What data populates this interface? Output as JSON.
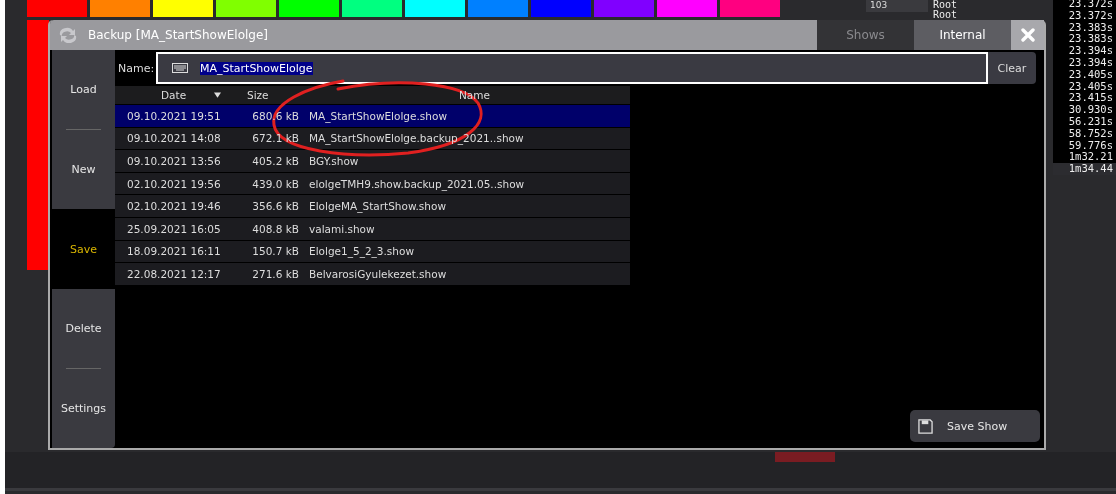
{
  "background": {
    "swatches": [
      {
        "color": "#ff0000"
      },
      {
        "color": "#ff8000"
      },
      {
        "color": "#ffff00"
      },
      {
        "color": "#80ff00"
      },
      {
        "color": "#00ff00"
      },
      {
        "color": "#00ff80"
      },
      {
        "color": "#00ffff"
      },
      {
        "color": "#0080ff"
      },
      {
        "color": "#0000ff"
      },
      {
        "color": "#8000ff"
      },
      {
        "color": "#ff00ff"
      },
      {
        "color": "#ff0080"
      }
    ],
    "counter": "103",
    "roots": [
      "Root",
      "Root"
    ],
    "timings": [
      {
        "text": "23.372s",
        "selected": false
      },
      {
        "text": "23.372s",
        "selected": false
      },
      {
        "text": "23.383s",
        "selected": false
      },
      {
        "text": "23.383s",
        "selected": false
      },
      {
        "text": "23.394s",
        "selected": false
      },
      {
        "text": "23.394s",
        "selected": false
      },
      {
        "text": "23.405s",
        "selected": false
      },
      {
        "text": "23.405s",
        "selected": false
      },
      {
        "text": "23.415s",
        "selected": false
      },
      {
        "text": "30.930s",
        "selected": false
      },
      {
        "text": "56.231s",
        "selected": false
      },
      {
        "text": "58.752s",
        "selected": false
      },
      {
        "text": "59.776s",
        "selected": false
      },
      {
        "text": "1m32.21",
        "selected": false
      },
      {
        "text": "1m34.44",
        "selected": true
      }
    ]
  },
  "window": {
    "title": "Backup [MA_StartShowElolge]",
    "tabs": [
      {
        "label": "Shows",
        "selected": false
      },
      {
        "label": "Internal",
        "selected": true
      }
    ],
    "name_field": {
      "label": "Name:",
      "value": "MA_StartShowElolge"
    },
    "clear_button": "Clear",
    "sidebar": [
      {
        "label": "Load",
        "selected": false
      },
      {
        "label": "New",
        "selected": false
      },
      {
        "label": "Save",
        "selected": true
      },
      {
        "label": "Delete",
        "selected": false
      },
      {
        "label": "Settings",
        "selected": false
      }
    ],
    "table": {
      "columns": [
        {
          "label": "Date",
          "sorted": true
        },
        {
          "label": "Size",
          "sorted": false
        },
        {
          "label": "Name",
          "sorted": false
        }
      ],
      "rows": [
        {
          "date": "09.10.2021 19:51",
          "size": "680.6 kB",
          "name": "MA_StartShowElolge.show",
          "selected": true
        },
        {
          "date": "09.10.2021 14:08",
          "size": "672.1 kB",
          "name": "MA_StartShowElolge.backup_2021..show",
          "selected": false
        },
        {
          "date": "09.10.2021 13:56",
          "size": "405.2 kB",
          "name": "BGY.show",
          "selected": false
        },
        {
          "date": "02.10.2021 19:56",
          "size": "439.0 kB",
          "name": "elolgeTMH9.show.backup_2021.05..show",
          "selected": false
        },
        {
          "date": "02.10.2021 19:46",
          "size": "356.6 kB",
          "name": "ElolgeMA_StartShow.show",
          "selected": false
        },
        {
          "date": "25.09.2021 16:05",
          "size": "408.8 kB",
          "name": "valami.show",
          "selected": false
        },
        {
          "date": "18.09.2021 16:11",
          "size": "150.7 kB",
          "name": "Elolge1_5_2_3.show",
          "selected": false
        },
        {
          "date": "22.08.2021 12:17",
          "size": "271.6 kB",
          "name": "BelvarosiGyulekezet.show",
          "selected": false
        }
      ]
    },
    "save_button": "Save Show"
  }
}
